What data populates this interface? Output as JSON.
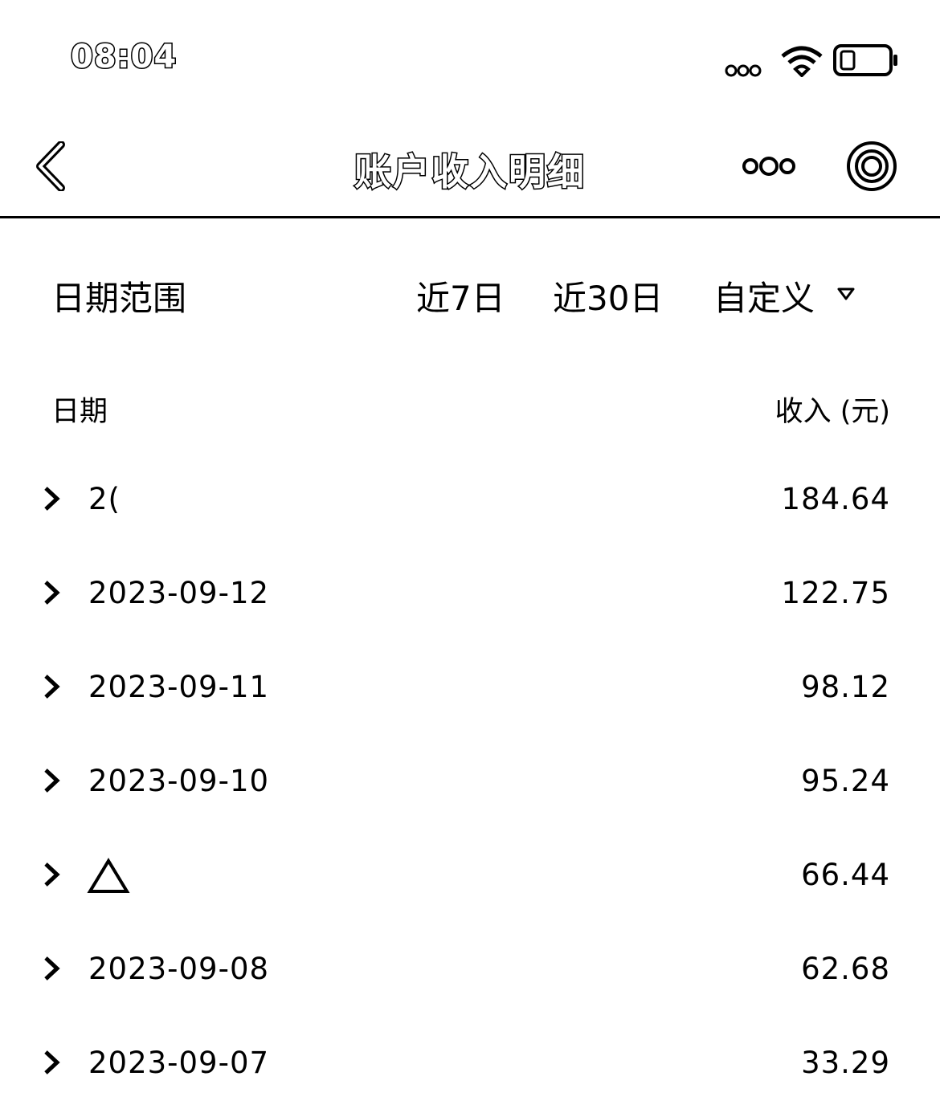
{
  "status_bar": {
    "time": "08:04",
    "icons": [
      "signal-icon",
      "wifi-icon",
      "battery-icon"
    ]
  },
  "nav": {
    "title": "账户收入明细",
    "icons": [
      "back-icon",
      "more-icon",
      "target-icon"
    ]
  },
  "filter": {
    "label": "日期范围",
    "options": [
      "近7日",
      "近30日",
      "自定义"
    ]
  },
  "table": {
    "headers": {
      "date": "日期",
      "income": "收入 (元)"
    },
    "rows": [
      {
        "date": "2(",
        "amount": "184.64"
      },
      {
        "date": "2023-09-12",
        "amount": "122.75"
      },
      {
        "date": "2023-09-11",
        "amount": "98.12"
      },
      {
        "date": "2023-09-10",
        "amount": "95.24"
      },
      {
        "date": "",
        "amount": "66.44"
      },
      {
        "date": "2023-09-08",
        "amount": "62.68"
      },
      {
        "date": "2023-09-07",
        "amount": "33.29"
      }
    ]
  }
}
